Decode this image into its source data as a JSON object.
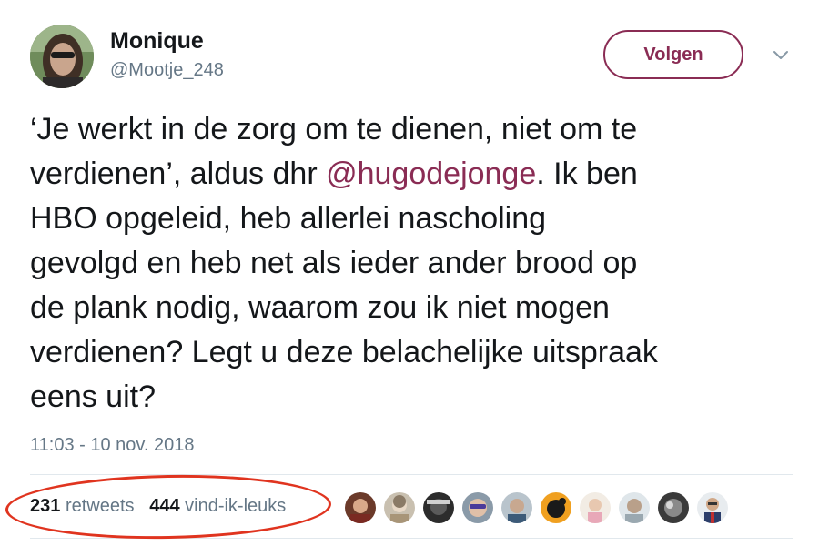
{
  "user": {
    "name": "Monique",
    "handle": "@Mootje_248"
  },
  "follow_button": {
    "label": "Volgen"
  },
  "tweet": {
    "lines": [
      "‘Je werkt in de zorg om te dienen, niet om te",
      "verdienen’, aldus dhr ",
      ". Ik ben",
      "HBO opgeleid, heb allerlei nascholing",
      "gevolgd en heb net als ieder ander brood op",
      "de plank nodig, waarom zou ik niet mogen",
      "verdienen? Legt u deze belachelijke uitspraak",
      "eens uit?"
    ],
    "mention": "@hugodejonge"
  },
  "timestamp": "11:03 - 10 nov. 2018",
  "stats": {
    "retweets_count": "231",
    "retweets_label": "retweets",
    "likes_count": "444",
    "likes_label": "vind-ik-leuks"
  },
  "colors": {
    "accent": "#8a2c54",
    "annotation_circle": "#e0341f",
    "secondary_text": "#657786"
  }
}
